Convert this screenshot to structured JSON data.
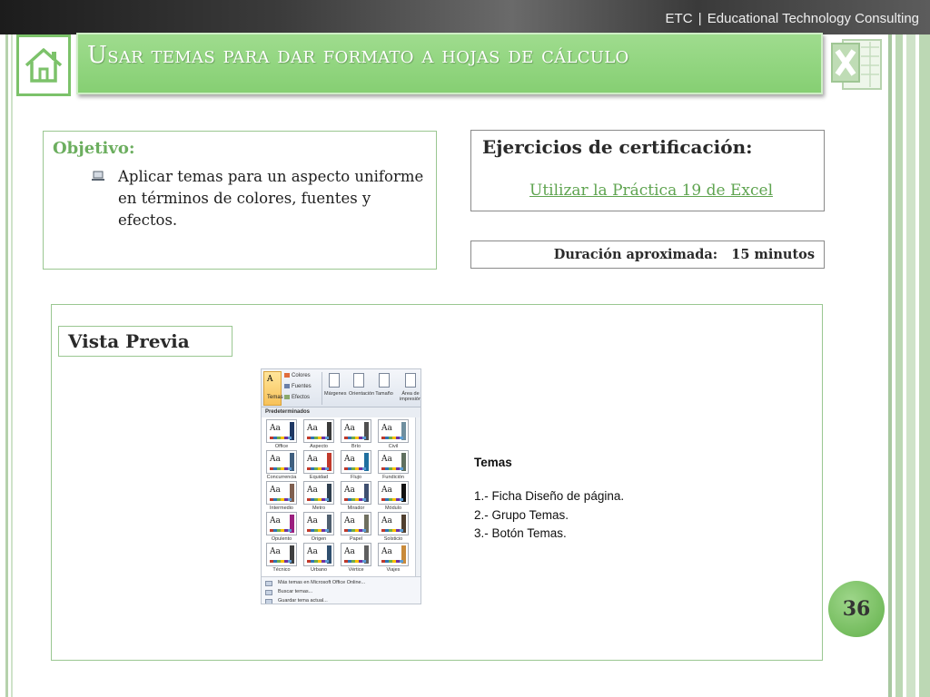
{
  "header": {
    "brand_code": "ETC",
    "brand_separator": "|",
    "brand_name": "Educational Technology Consulting"
  },
  "slide": {
    "title": "Usar temas para dar formato a hojas de cálculo",
    "page_number": "36"
  },
  "objective": {
    "heading": "Objetivo:",
    "bullet": "Aplicar temas para un aspecto uniforme en términos de colores, fuentes y efectos."
  },
  "certification": {
    "heading": "Ejercicios de  certificación:",
    "link": "Utilizar la Práctica 19 de Excel"
  },
  "duration": {
    "text": "Duración aproximada:   15 minutos"
  },
  "preview": {
    "label": "Vista Previa"
  },
  "gallery": {
    "ribbon": {
      "temas": "Temas",
      "colores": "Colores",
      "fuentes": "Fuentes",
      "efectos": "Efectos",
      "margenes": "Márgenes",
      "orientacion": "Orientación",
      "tamano": "Tamaño",
      "area": "Área de impresión"
    },
    "section_header": "Predeterminados",
    "themes": [
      {
        "name": "Office",
        "bar_color": "#1f3864"
      },
      {
        "name": "Aspecto",
        "bar_color": "#3a3a3a"
      },
      {
        "name": "Brío",
        "bar_color": "#4f4f4f"
      },
      {
        "name": "Civil",
        "bar_color": "#6f8f9f"
      },
      {
        "name": "Concurrencia",
        "bar_color": "#3f5f7f"
      },
      {
        "name": "Equidad",
        "bar_color": "#c0392b"
      },
      {
        "name": "Flujo",
        "bar_color": "#1f6f9f"
      },
      {
        "name": "Fundición",
        "bar_color": "#5f6f5f"
      },
      {
        "name": "Intermedio",
        "bar_color": "#7f5f4f"
      },
      {
        "name": "Metro",
        "bar_color": "#2f3f4f"
      },
      {
        "name": "Mirador",
        "bar_color": "#3f4f6f"
      },
      {
        "name": "Módulo",
        "bar_color": "#111111"
      },
      {
        "name": "Opulento",
        "bar_color": "#9b1f7f"
      },
      {
        "name": "Origen",
        "bar_color": "#4f5f6f"
      },
      {
        "name": "Papel",
        "bar_color": "#6f6f5f"
      },
      {
        "name": "Solsticio",
        "bar_color": "#4f3f2f"
      },
      {
        "name": "Técnico",
        "bar_color": "#3f3f3f"
      },
      {
        "name": "Urbano",
        "bar_color": "#2f4f6f"
      },
      {
        "name": "Vértice",
        "bar_color": "#5f5f5f"
      },
      {
        "name": "Viajes",
        "bar_color": "#c98a3a"
      }
    ],
    "footer": {
      "more": "Más temas en Microsoft Office Online...",
      "browse": "Buscar temas...",
      "save": "Guardar tema actual..."
    }
  },
  "notes": {
    "title": "Temas",
    "steps": [
      "1.- Ficha Diseño de página.",
      "2.- Grupo Temas.",
      "3.- Botón Temas."
    ]
  },
  "colors": {
    "accent_green": "#86cf73",
    "heading_green": "#6cae5f"
  }
}
